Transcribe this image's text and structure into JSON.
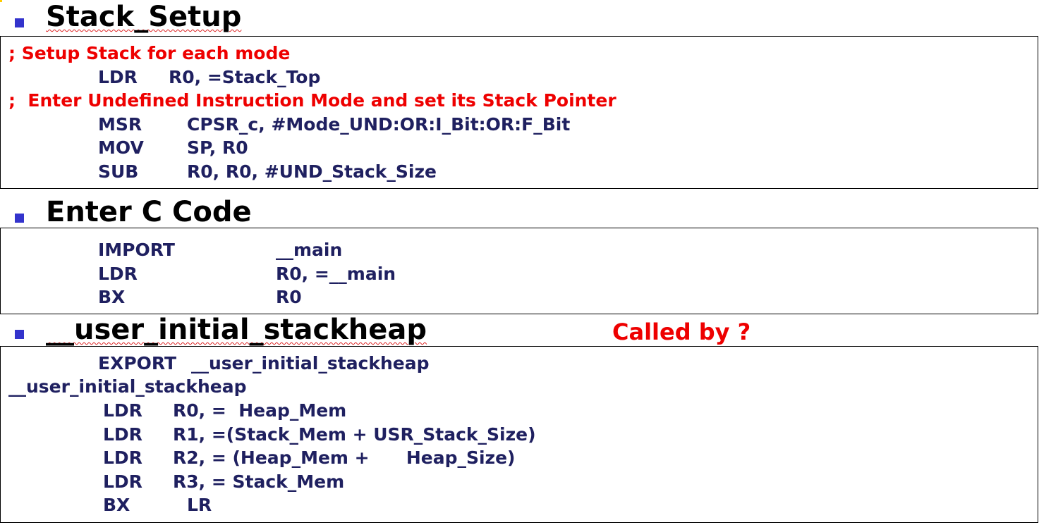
{
  "sections": [
    {
      "heading": "Stack_Setup",
      "lines": [
        {
          "type": "comment",
          "text": "; Setup Stack for each mode"
        },
        {
          "type": "code",
          "op": "LDR",
          "args": "R0, =Stack_Top"
        },
        {
          "type": "comment",
          "text": ";  Enter Undefined Instruction Mode and set its Stack Pointer"
        },
        {
          "type": "code",
          "op": "MSR",
          "args": "CPSR_c, #Mode_UND:OR:I_Bit:OR:F_Bit"
        },
        {
          "type": "code",
          "op": "MOV",
          "args": "SP, R0"
        },
        {
          "type": "code",
          "op": "SUB",
          "args": "R0, R0, #UND_Stack_Size"
        }
      ]
    },
    {
      "heading": "Enter C Code",
      "lines": [
        {
          "type": "code",
          "op": "IMPORT",
          "args": "__main"
        },
        {
          "type": "code",
          "op": "LDR",
          "args": "R0, =__main"
        },
        {
          "type": "code",
          "op": "BX",
          "args": "R0"
        }
      ]
    },
    {
      "heading": "__user_initial_stackheap",
      "note": "Called by ?",
      "lines": [
        {
          "type": "code",
          "op": "EXPORT",
          "args": "__user_initial_stackheap"
        },
        {
          "type": "label",
          "text": "__user_initial_stackheap"
        },
        {
          "type": "code",
          "op": "LDR",
          "args": "R0, =  Heap_Mem"
        },
        {
          "type": "code",
          "op": "LDR",
          "args": "R1, =(Stack_Mem + USR_Stack_Size)"
        },
        {
          "type": "code",
          "op": "LDR",
          "args": "R2, = (Heap_Mem +      Heap_Size)"
        },
        {
          "type": "code",
          "op": "LDR",
          "args": "R3, = Stack_Mem"
        },
        {
          "type": "code",
          "op": "BX",
          "args": "LR"
        }
      ]
    }
  ],
  "colors": {
    "bullet": "#3333cc",
    "code": "#1f2060",
    "comment": "#ee0000",
    "heading": "#000000"
  }
}
